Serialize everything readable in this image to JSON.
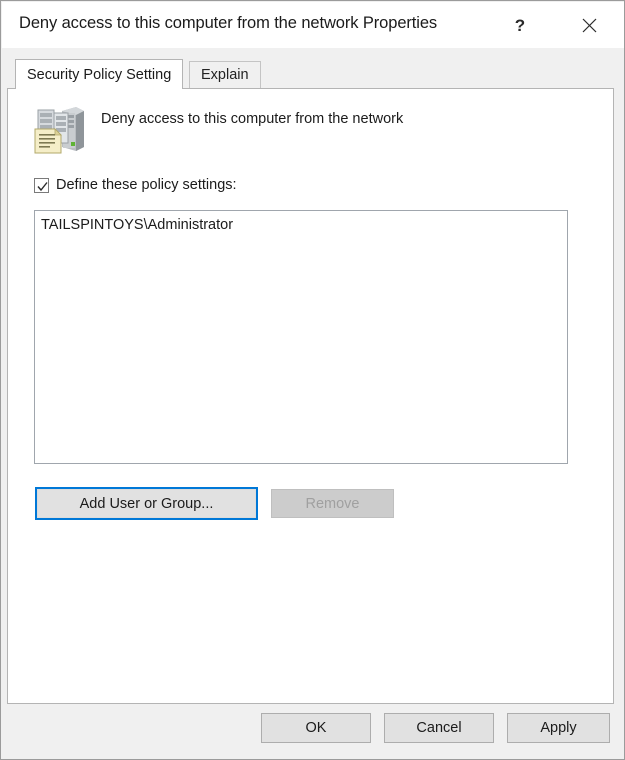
{
  "window": {
    "title": "Deny access to this computer from the network Properties",
    "help_icon": "question-mark-icon",
    "close_icon": "close-x-icon"
  },
  "tabs": [
    {
      "label": "Security Policy Setting",
      "active": true
    },
    {
      "label": "Explain",
      "active": false
    }
  ],
  "policy": {
    "icon": "server-policy-icon",
    "name": "Deny access to this computer from the network",
    "define_checkbox": {
      "label": "Define these policy settings:",
      "checked": true,
      "check_icon": "checkmark-icon"
    },
    "entries": [
      "TAILSPINTOYS\\Administrator"
    ]
  },
  "buttons": {
    "add_user_or_group": "Add User or Group...",
    "remove": "Remove",
    "ok": "OK",
    "cancel": "Cancel",
    "apply": "Apply"
  },
  "colors": {
    "focus_ring": "#0078d7",
    "window_background": "#f0f0f0",
    "panel_background": "#ffffff",
    "button_face": "#e1e1e1",
    "button_disabled_face": "#cccccc",
    "button_disabled_text": "#a0a0a0",
    "text": "#1b1b1b",
    "border": "#b4b4b4"
  }
}
